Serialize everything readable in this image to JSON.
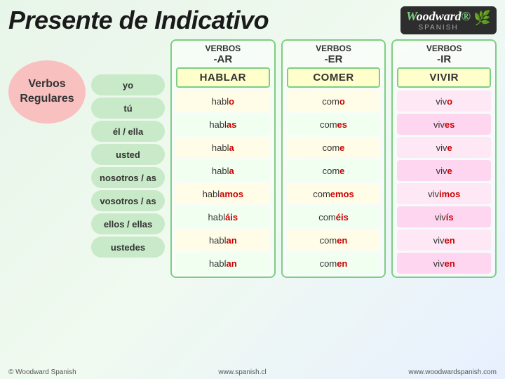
{
  "header": {
    "title": "Presente de Indicativo",
    "logo": {
      "brand": "Woodward",
      "sub": "SPANISH",
      "reg": "®"
    }
  },
  "left_label": {
    "line1": "Verbos",
    "line2": "Regulares"
  },
  "columns": [
    {
      "id": "ar",
      "header_verbos": "VERBOS",
      "header_suffix": "-AR",
      "verb_name": "HABLAR",
      "forms": [
        {
          "stem": "habl",
          "ending": "o"
        },
        {
          "stem": "habl",
          "ending": "as"
        },
        {
          "stem": "habl",
          "ending": "a"
        },
        {
          "stem": "habl",
          "ending": "a"
        },
        {
          "stem": "habl",
          "ending": "amos"
        },
        {
          "stem": "habl",
          "ending": "áis"
        },
        {
          "stem": "habl",
          "ending": "an"
        },
        {
          "stem": "habl",
          "ending": "an"
        }
      ]
    },
    {
      "id": "er",
      "header_verbos": "VERBOS",
      "header_suffix": "-ER",
      "verb_name": "COMER",
      "forms": [
        {
          "stem": "com",
          "ending": "o"
        },
        {
          "stem": "com",
          "ending": "es"
        },
        {
          "stem": "com",
          "ending": "e"
        },
        {
          "stem": "com",
          "ending": "e"
        },
        {
          "stem": "com",
          "ending": "emos"
        },
        {
          "stem": "com",
          "ending": "éis"
        },
        {
          "stem": "com",
          "ending": "en"
        },
        {
          "stem": "com",
          "ending": "en"
        }
      ]
    },
    {
      "id": "ir",
      "header_verbos": "VERBOS",
      "header_suffix": "-IR",
      "verb_name": "VIVIR",
      "forms": [
        {
          "stem": "viv",
          "ending": "o"
        },
        {
          "stem": "viv",
          "ending": "es"
        },
        {
          "stem": "viv",
          "ending": "e"
        },
        {
          "stem": "viv",
          "ending": "e"
        },
        {
          "stem": "viv",
          "ending": "imos"
        },
        {
          "stem": "viv",
          "ending": "ís"
        },
        {
          "stem": "viv",
          "ending": "en"
        },
        {
          "stem": "viv",
          "ending": "en"
        }
      ]
    }
  ],
  "subjects": [
    "yo",
    "tú",
    "él / ella",
    "usted",
    "nosotros / as",
    "vosotros / as",
    "ellos / ellas",
    "ustedes"
  ],
  "footer": {
    "left": "© Woodward Spanish",
    "center": "www.spanish.cl",
    "right": "www.woodwardspanish.com"
  }
}
